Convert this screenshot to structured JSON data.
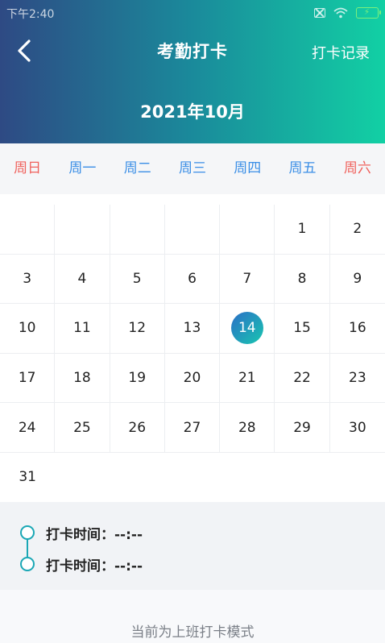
{
  "status_bar": {
    "time": "下午2:40"
  },
  "header": {
    "title": "考勤打卡",
    "record_link": "打卡记录",
    "month": "2021年10月"
  },
  "weekdays": [
    "周日",
    "周一",
    "周二",
    "周三",
    "周四",
    "周五",
    "周六"
  ],
  "calendar": {
    "selected_day": "14",
    "weeks": [
      [
        "",
        "",
        "",
        "",
        "",
        "1",
        "2"
      ],
      [
        "3",
        "4",
        "5",
        "6",
        "7",
        "8",
        "9"
      ],
      [
        "10",
        "11",
        "12",
        "13",
        "14",
        "15",
        "16"
      ],
      [
        "17",
        "18",
        "19",
        "20",
        "21",
        "22",
        "23"
      ],
      [
        "24",
        "25",
        "26",
        "27",
        "28",
        "29",
        "30"
      ],
      [
        "31",
        "",
        "",
        "",
        "",
        "",
        ""
      ]
    ]
  },
  "punch": {
    "rows": [
      {
        "label": "打卡时间：",
        "value": "--:--"
      },
      {
        "label": "打卡时间：",
        "value": "--:--"
      }
    ]
  },
  "mode_text": "当前为上班打卡模式",
  "colors": {
    "accent_blue": "#3a8ee6",
    "weekend_red": "#f0615c",
    "teal": "#1aa7b5"
  }
}
